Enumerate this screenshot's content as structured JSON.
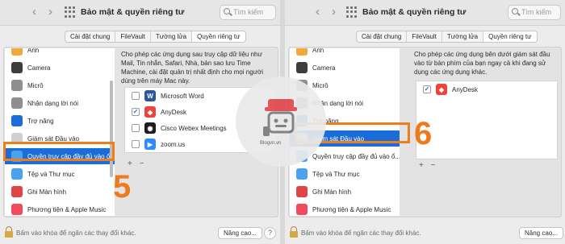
{
  "window": {
    "title": "Bảo mật & quyền riêng tư",
    "search_placeholder": "Tìm kiếm",
    "back": "‹",
    "forward": "›"
  },
  "tabs": [
    "Cài đặt chung",
    "FileVault",
    "Tường lửa",
    "Quyền riêng tư"
  ],
  "left": {
    "sidebar": [
      {
        "label": "Ảnh",
        "icon": "photos-icon",
        "color": "#f4a73a"
      },
      {
        "label": "Camera",
        "icon": "camera-icon",
        "color": "#3d3d3d"
      },
      {
        "label": "Micrô",
        "icon": "microphone-icon",
        "color": "#8e8e8e"
      },
      {
        "label": "Nhận dạng lời nói",
        "icon": "speech-icon",
        "color": "#8e8e8e"
      },
      {
        "label": "Trợ năng",
        "icon": "accessibility-icon",
        "color": "#1a6cd9"
      },
      {
        "label": "Giám sát Đầu vào",
        "icon": "keyboard-icon",
        "color": "#d0d0d0"
      },
      {
        "label": "Quyền truy cập đầy đủ vào ổ...",
        "icon": "folder-icon",
        "color": "#4aa2ef"
      },
      {
        "label": "Tệp và Thư mục",
        "icon": "folder-icon",
        "color": "#4aa2ef"
      },
      {
        "label": "Ghi Màn hình",
        "icon": "screen-record-icon",
        "color": "#e04545"
      },
      {
        "label": "Phương tiện & Apple Music",
        "icon": "music-icon",
        "color": "#f04a5c"
      }
    ],
    "description": "Cho phép các ứng dụng sau truy cập dữ liệu như Mail, Tin nhắn, Safari, Nhà, bản sao lưu Time Machine, cài đặt quản trị nhất định cho mọi người dùng trên máy Mac này.",
    "apps": [
      {
        "name": "Microsoft Word",
        "checked": false,
        "icon": "word-icon",
        "color": "#2b579a",
        "glyph": "W"
      },
      {
        "name": "AnyDesk",
        "checked": true,
        "icon": "anydesk-icon",
        "color": "#ef443b",
        "glyph": "◆"
      },
      {
        "name": "Cisco Webex Meetings",
        "checked": false,
        "icon": "webex-icon",
        "color": "#1d1d1d",
        "glyph": "◉"
      },
      {
        "name": "zoom.us",
        "checked": false,
        "icon": "zoom-icon",
        "color": "#2d8cff",
        "glyph": "▶"
      }
    ],
    "step": "5"
  },
  "right": {
    "sidebar": [
      {
        "label": "Ảnh",
        "icon": "photos-icon",
        "color": "#f4a73a"
      },
      {
        "label": "Camera",
        "icon": "camera-icon",
        "color": "#3d3d3d"
      },
      {
        "label": "Micrô",
        "icon": "microphone-icon",
        "color": "#8e8e8e"
      },
      {
        "label": "Nhận dạng lời nói",
        "icon": "speech-icon",
        "color": "#8e8e8e"
      },
      {
        "label": "Trợ năng",
        "icon": "accessibility-icon",
        "color": "#1a6cd9"
      },
      {
        "label": "Giám sát Đầu vào",
        "icon": "keyboard-icon",
        "color": "#d0d0d0"
      },
      {
        "label": "Quyền truy cập đầy đủ vào ổ...",
        "icon": "folder-icon",
        "color": "#4aa2ef"
      },
      {
        "label": "Tệp và Thư mục",
        "icon": "folder-icon",
        "color": "#4aa2ef"
      },
      {
        "label": "Ghi Màn hình",
        "icon": "screen-record-icon",
        "color": "#e04545"
      },
      {
        "label": "Phương tiện & Apple Music",
        "icon": "music-icon",
        "color": "#f04a5c"
      }
    ],
    "description": "Cho phép các ứng dụng bên dưới giám sát đầu vào từ bàn phím của bạn ngay cả khi đang sử dụng các ứng dụng khác.",
    "apps": [
      {
        "name": "AnyDesk",
        "checked": true,
        "icon": "anydesk-icon",
        "color": "#ef443b",
        "glyph": "◆"
      }
    ],
    "step": "6"
  },
  "bottom": {
    "lock_text": "Bấm vào khóa để ngăn các thay đổi khác.",
    "advanced_button": "Nâng cao...",
    "help": "?"
  },
  "list_controls": "+ −",
  "watermark": "Blogvn.vn",
  "colors": {
    "accent": "#1a6cd9",
    "callout": "#ee7d1a"
  }
}
